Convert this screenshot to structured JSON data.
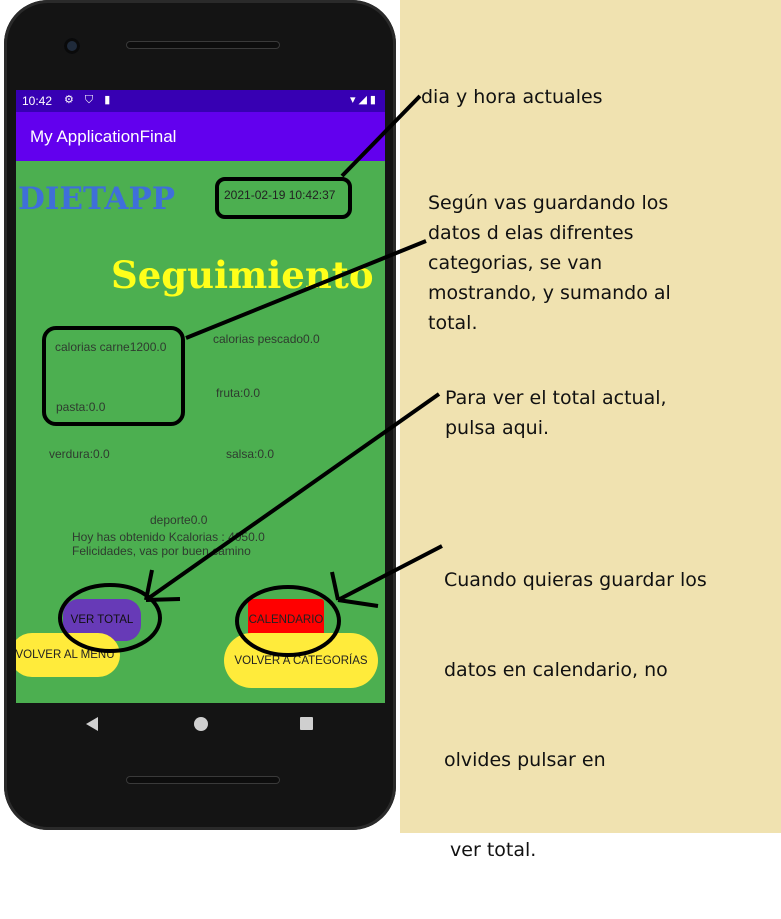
{
  "status_bar": {
    "time": "10:42",
    "left_icons": "⚙ ⛉ ▮",
    "right_icons": "▾◢▮"
  },
  "app_bar": {
    "title": "My ApplicationFinal"
  },
  "screen": {
    "logo": "DIETAPP",
    "datetime": "2021-02-19 10:42:37",
    "heading": "Seguimiento",
    "items": {
      "carne": "calorias carne1200.0",
      "pescado": "calorias pescado0.0",
      "pasta": "pasta:0.0",
      "fruta": "fruta:0.0",
      "verdura": "verdura:0.0",
      "salsa": "salsa:0.0",
      "deporte": "deporte0.0"
    },
    "message_line1": "Hoy has obtenido Kcalorias : 4050.0",
    "message_line2": "Felicidades, vas por buen camino",
    "buttons": {
      "ver_total": "VER TOTAL",
      "calendario": "CALENDARIO",
      "volver_menu": "VOLVER AL MENU",
      "volver_categorias": "VOLVER A CATEGORÍAS"
    }
  },
  "annotations": {
    "a1": "dia y hora actuales",
    "a2_l1": "Según vas guardando los",
    "a2_l2": "datos d elas difrentes",
    "a2_l3": "categorias, se van",
    "a2_l4": "mostrando, y sumando al",
    "a2_l5": "total.",
    "a3_l1": "Para ver el total actual,",
    "a3_l2": "pulsa aqui.",
    "a4_l1": "Cuando quieras guardar los",
    "a4_l2": "datos en calendario, no",
    "a4_l3": "olvides pulsar en",
    "a4_l4": " ver total."
  },
  "colors": {
    "background": "#f0e2b0",
    "statusbar": "#3700b3",
    "appbar": "#6200ee",
    "screen": "#4caf50",
    "logo": "#3f6fd9",
    "heading": "#ffff1a",
    "ver_total_button": "#673ab7",
    "calendario_button": "#ff0000",
    "volver_buttons": "#ffeb3b"
  },
  "icons": [
    "settings-icon",
    "shield-icon",
    "sd-card-icon",
    "wifi-icon",
    "signal-icon",
    "battery-icon",
    "back-icon",
    "home-icon",
    "recents-icon"
  ]
}
